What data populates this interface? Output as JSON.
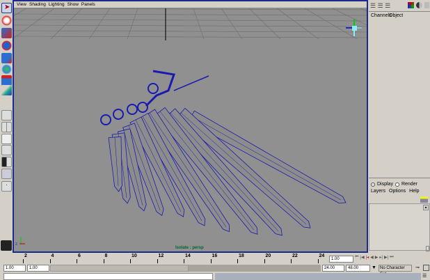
{
  "viewport": {
    "menu": [
      "View",
      "Shading",
      "Lighting",
      "Show",
      "Panels"
    ],
    "camera_label": "Isolate : persp"
  },
  "channel_box": {
    "tabs": [
      "Channels",
      "Object"
    ]
  },
  "layer_editor": {
    "display_label": "Display",
    "render_label": "Render",
    "menu": [
      "Layers",
      "Options",
      "Help"
    ]
  },
  "timeline": {
    "ticks": [
      "2",
      "4",
      "6",
      "8",
      "10",
      "12",
      "14",
      "16",
      "18",
      "20",
      "22",
      "24"
    ],
    "current_frame": "1.00"
  },
  "range": {
    "start": "1.00",
    "playback_start": "1.00",
    "playback_end": "24.00",
    "end": "48.00",
    "character_set": "No Character Set"
  },
  "colors": {
    "accent": "#1c2a8a",
    "viewport_bg": "#909090",
    "wire": "#1a1ab0"
  }
}
